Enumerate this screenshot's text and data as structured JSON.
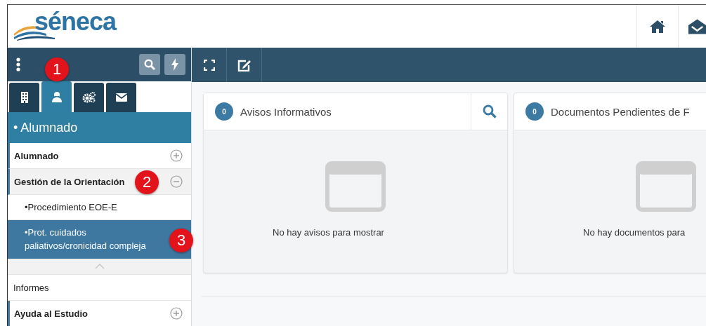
{
  "header": {
    "logo": "séneca"
  },
  "sidebar": {
    "tabs": [
      {
        "kind": "building",
        "selected": false
      },
      {
        "kind": "people",
        "selected": true,
        "marker": "1"
      },
      {
        "kind": "gears",
        "selected": false
      },
      {
        "kind": "mail",
        "selected": false
      }
    ],
    "section_title": "• Alumnado",
    "menu": [
      {
        "kind": "group",
        "label": "Alumnado",
        "expanded": false
      },
      {
        "kind": "group",
        "label": "Gestión de la Orientación",
        "expanded": true,
        "marker": "2",
        "children": [
          {
            "label": "•Procedimiento EOE-E",
            "selected": false
          },
          {
            "label": "•Prot. cuidados paliativos/cronicidad compleja",
            "selected": true,
            "marker": "3"
          }
        ]
      },
      {
        "kind": "link",
        "label": "Informes"
      },
      {
        "kind": "group",
        "label": "Ayuda al Estudio",
        "expanded": false
      }
    ]
  },
  "panels": [
    {
      "count": "0",
      "title": "Avisos Informativos",
      "search": true,
      "empty_message": "No hay avisos para mostrar"
    },
    {
      "count": "0",
      "title": "Documentos Pendientes de F",
      "empty_message": "No hay documentos para"
    }
  ]
}
